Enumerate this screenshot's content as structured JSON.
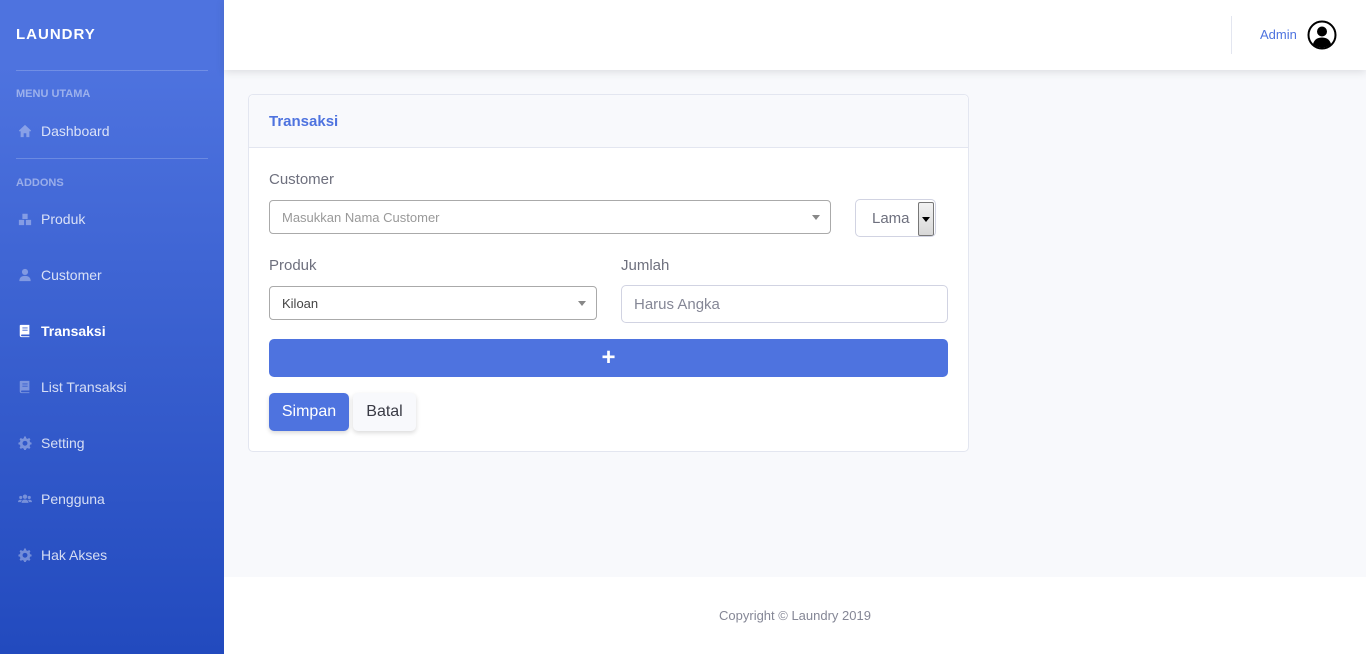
{
  "sidebar": {
    "brand": "LAUNDRY",
    "sections": [
      {
        "heading": "MENU UTAMA"
      },
      {
        "heading": "ADDONS"
      }
    ],
    "items": [
      {
        "label": "Dashboard",
        "icon": "home-icon",
        "active": false
      },
      {
        "label": "Produk",
        "icon": "boxes-icon",
        "active": false
      },
      {
        "label": "Customer",
        "icon": "user-icon",
        "active": false
      },
      {
        "label": "Transaksi",
        "icon": "book-icon",
        "active": true
      },
      {
        "label": "List Transaksi",
        "icon": "book-icon",
        "active": false
      },
      {
        "label": "Setting",
        "icon": "gear-icon",
        "active": false
      },
      {
        "label": "Pengguna",
        "icon": "users-icon",
        "active": false
      },
      {
        "label": "Hak Akses",
        "icon": "gear-icon",
        "active": false
      }
    ]
  },
  "topbar": {
    "user_name": "Admin",
    "avatar_icon": "user-circle-icon"
  },
  "card": {
    "title": "Transaksi",
    "customer_label": "Customer",
    "customer_placeholder": "Masukkan Nama Customer",
    "customer_type_value": "Lama",
    "produk_label": "Produk",
    "produk_value": "Kiloan",
    "jumlah_label": "Jumlah",
    "jumlah_placeholder": "Harus Angka",
    "add_label": "+",
    "save_label": "Simpan",
    "cancel_label": "Batal"
  },
  "footer": {
    "copyright": "Copyright © Laundry 2019"
  },
  "colors": {
    "primary": "#4e73df",
    "sidebar_gradient_end": "#224abe",
    "background": "#f8f9fc"
  }
}
